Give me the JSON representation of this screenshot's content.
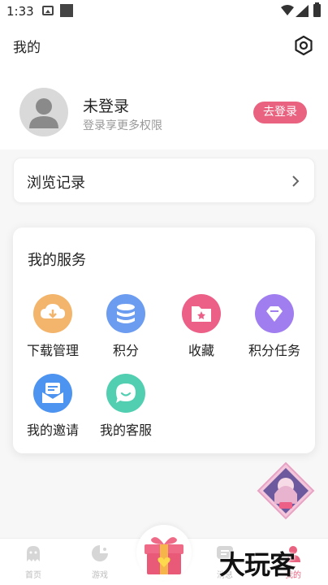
{
  "status_bar": {
    "time": "1:33"
  },
  "header": {
    "title": "我的",
    "settings_icon": "gear-icon"
  },
  "profile": {
    "username": "未登录",
    "hint": "登录享更多权限",
    "login_button": "去登录",
    "accent_color": "#e9627f"
  },
  "history": {
    "label": "浏览记录"
  },
  "services": {
    "title": "我的服务",
    "items": [
      {
        "label": "下载管理",
        "icon": "download-icon",
        "color": "#f3b56b"
      },
      {
        "label": "积分",
        "icon": "coins-icon",
        "color": "#6c9cf0"
      },
      {
        "label": "收藏",
        "icon": "folder-star-icon",
        "color": "#ec5f86"
      },
      {
        "label": "积分任务",
        "icon": "gem-icon",
        "color": "#a07ef0"
      },
      {
        "label": "我的邀请",
        "icon": "invite-mail-icon",
        "color": "#4d93f0"
      },
      {
        "label": "我的客服",
        "icon": "chat-icon",
        "color": "#51cfb0"
      }
    ]
  },
  "tabbar": {
    "items": [
      {
        "label": "首页",
        "icon": "ghost-icon"
      },
      {
        "label": "游戏",
        "icon": "gamepad-icon"
      },
      {
        "label": "消息",
        "icon": "message-icon"
      },
      {
        "label": "我的",
        "icon": "profile-icon"
      }
    ],
    "gift_icon": "gift-icon"
  },
  "watermark": "大玩客"
}
